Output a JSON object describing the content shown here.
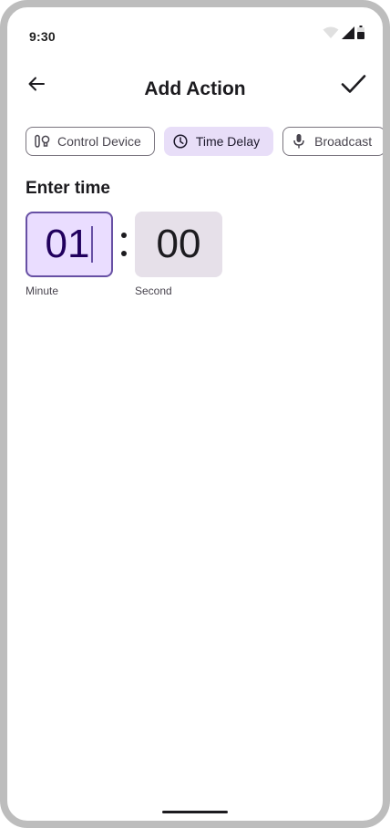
{
  "status_bar": {
    "time": "9:30",
    "icons": [
      "wifi-icon",
      "signal-icon",
      "battery-icon"
    ]
  },
  "top_bar": {
    "title": "Add Action",
    "back_icon": "arrow-back-icon",
    "confirm_icon": "check-icon"
  },
  "chips": [
    {
      "label": "Control Device",
      "icon": "device-icon",
      "selected": false
    },
    {
      "label": "Time Delay",
      "icon": "clock-icon",
      "selected": true
    },
    {
      "label": "Broadcast",
      "icon": "mic-icon",
      "selected": false
    }
  ],
  "time_entry": {
    "heading": "Enter time",
    "minute_value": "01",
    "second_value": "00",
    "minute_label": "Minute",
    "second_label": "Second"
  },
  "colors": {
    "accent": "#6750a4",
    "selected_chip": "#e8def8",
    "focused_field": "#eaddff",
    "field_bg": "#e6e0e9"
  }
}
